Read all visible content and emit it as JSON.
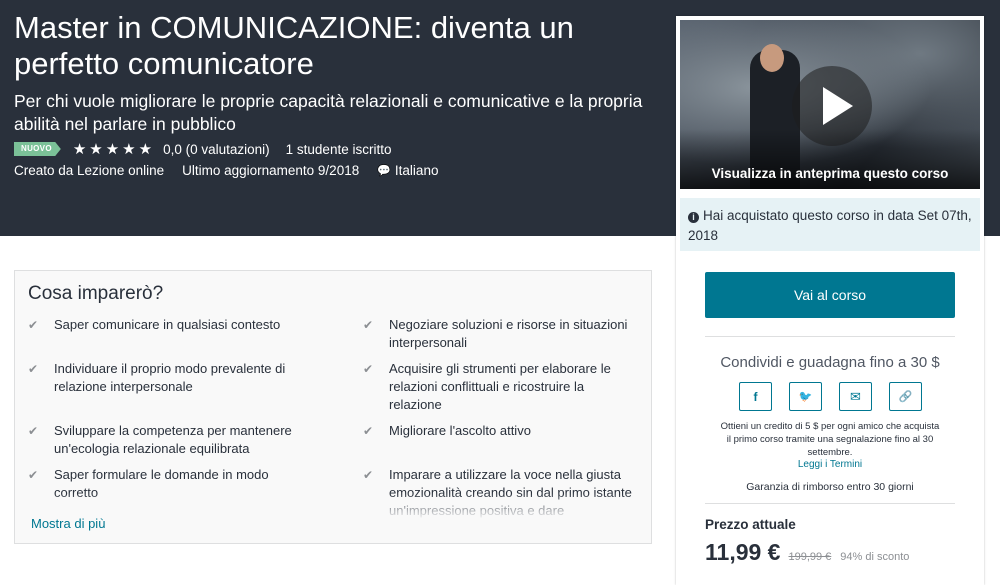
{
  "course": {
    "title": "Master in COMUNICAZIONE: diventa un perfetto comunicatore",
    "subtitle": "Per chi vuole migliorare le proprie capacità relazionali e comunicative e la propria abilità nel parlare in pubblico",
    "badge": "NUOVO",
    "stars": "★★★★★",
    "rating_text": "0,0 (0 valutazioni)",
    "students": "1 studente iscritto",
    "created_by": "Creato da Lezione online",
    "last_update": "Ultimo aggiornamento 9/2018",
    "language": "Italiano"
  },
  "learn": {
    "heading": "Cosa imparerò?",
    "items": [
      "Saper comunicare in qualsiasi contesto",
      "Negoziare soluzioni e risorse in situazioni interpersonali",
      "Individuare il proprio modo prevalente di relazione interpersonale",
      "Acquisire gli strumenti per elaborare le relazioni conflittuali e ricostruire la relazione",
      "Sviluppare la competenza per mantenere un'ecologia relazionale equilibrata",
      "Migliorare l'ascolto attivo",
      "Saper formulare le domande in modo corretto",
      "Imparare a utilizzare la voce nella giusta emozionalità creando sin dal primo istante un'impressione positiva e dare"
    ],
    "check_icon": "✔",
    "show_more": "Mostra di più"
  },
  "sidebar": {
    "preview_label": "Visualizza in anteprima questo corso",
    "purchased_text": "Hai acquistato questo corso in data Set 07th, 2018",
    "go_button": "Vai al corso",
    "share_title": "Condividi e guadagna fino a 30 $",
    "share_buttons": {
      "facebook": "f",
      "twitter": "🐦",
      "email": "✉",
      "link": "🔗"
    },
    "credit_text": "Ottieni un credito di 5 $ per ogni amico che acquista il primo corso tramite una segnalazione fino al 30 settembre.",
    "terms_link": "Leggi i Termini",
    "guarantee": "Garanzia di rimborso entro 30 giorni",
    "price_label": "Prezzo attuale",
    "price_current": "11,99 €",
    "price_old": "199,99 €",
    "price_discount": "94% di sconto"
  },
  "colors": {
    "hero_bg": "#29303b",
    "accent": "#007791",
    "badge": "#7bc198",
    "info_bg": "#e6f2f5"
  }
}
